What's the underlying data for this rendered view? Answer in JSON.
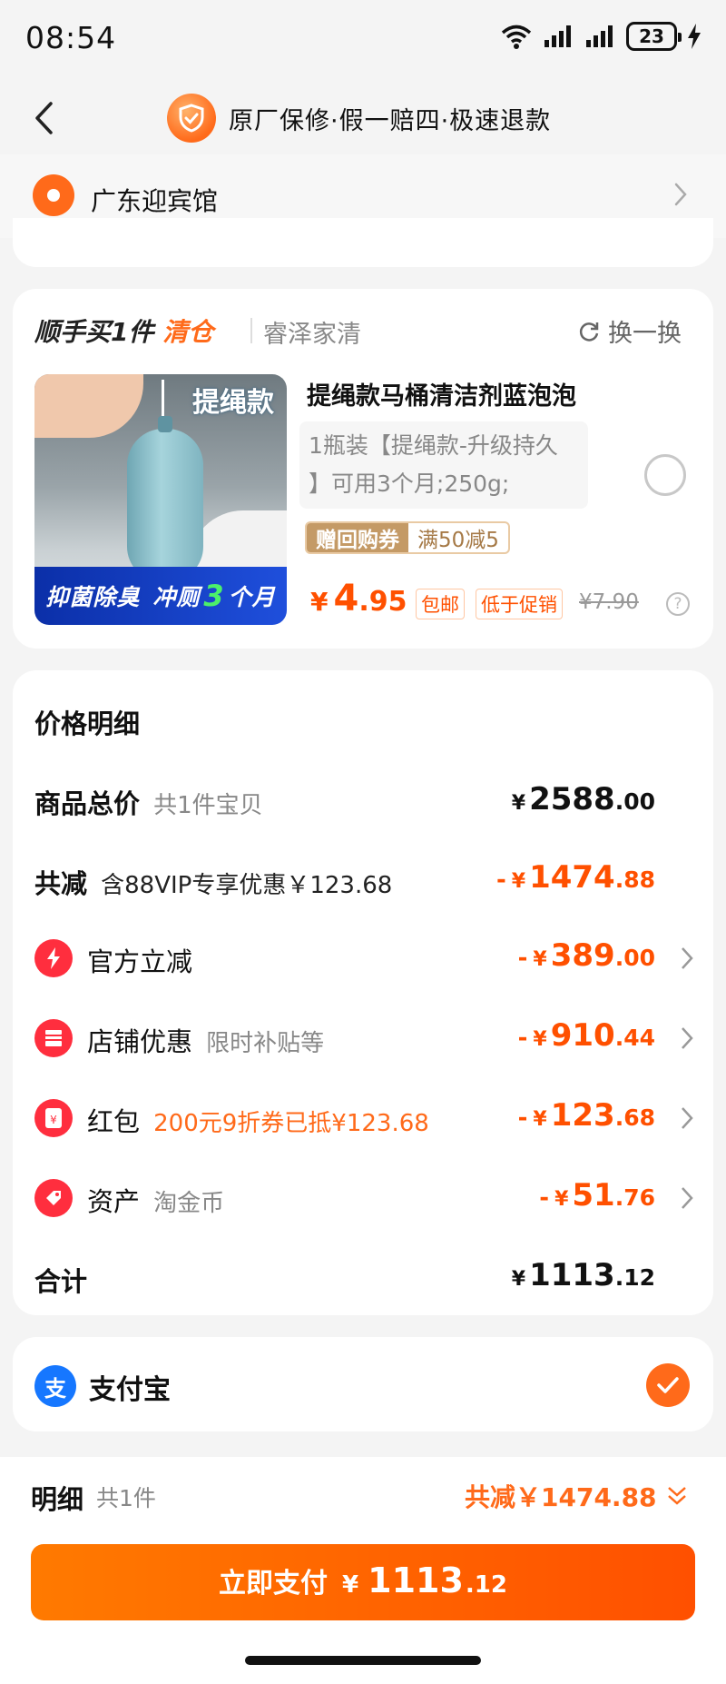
{
  "status_bar": {
    "time": "08:54",
    "battery": "23"
  },
  "header": {
    "guarantee_text": "原厂保修·假一赔四·极速退款"
  },
  "address": {
    "text": "广东迎宾馆"
  },
  "deal": {
    "title": "顺手买1件",
    "tag": "清仓",
    "shop": "睿泽家清",
    "refresh_label": "换一换"
  },
  "product": {
    "image_tag": "提绳款",
    "image_banner_a": "抑菌除臭",
    "image_banner_b": "冲厕",
    "image_banner_num": "3",
    "image_banner_c": "个月",
    "title": "提绳款马桶清洁剂蓝泡泡",
    "spec_line1": "1瓶装【提绳款-升级持久",
    "spec_line2": "】可用3个月;250g;",
    "coupon_left": "赠回购券",
    "coupon_right": "满50减5",
    "price_symbol": "¥",
    "price_int": "4",
    "price_dec": ".95",
    "badge_free": "包邮",
    "badge_promo": "低于促销",
    "original_price": "¥7.90",
    "help": "?"
  },
  "price_detail": {
    "title": "价格明细",
    "subtotal": {
      "label": "商品总价",
      "sub": "共1件宝贝",
      "yen": "¥",
      "int": "2588",
      "dec": ".00"
    },
    "discount": {
      "label": "共减",
      "sub": "含88VIP专享优惠￥123.68",
      "minus": "-",
      "yen": "¥",
      "int": "1474",
      "dec": ".88"
    },
    "items": [
      {
        "label": "官方立减",
        "sub": "",
        "minus": "-",
        "yen": "¥",
        "int": "389",
        "dec": ".00",
        "icon": "lightning-icon",
        "color": "#ff2e3e"
      },
      {
        "label": "店铺优惠",
        "sub": "限时补贴等",
        "minus": "-",
        "yen": "¥",
        "int": "910",
        "dec": ".44",
        "icon": "store-icon",
        "color": "#ff2e3e"
      },
      {
        "label": "红包",
        "sub": "200元9折券已抵¥123.68",
        "minus": "-",
        "yen": "¥",
        "int": "123",
        "dec": ".68",
        "icon": "red-packet-icon",
        "color": "#ff2e3e"
      },
      {
        "label": "资产",
        "sub": "淘金币",
        "minus": "-",
        "yen": "¥",
        "int": "51",
        "dec": ".76",
        "icon": "tag-icon",
        "color": "#ff2e3e"
      }
    ],
    "total": {
      "label": "合计",
      "yen": "¥",
      "int": "1113",
      "dec": ".12"
    }
  },
  "payment": {
    "name": "支付宝",
    "icon_char": "支"
  },
  "bottom": {
    "detail_label": "明细",
    "detail_count": "共1件",
    "total_off": "共减￥1474.88",
    "pay_label": "立即支付",
    "pay_yen": "¥",
    "pay_int": "1113",
    "pay_dec": ".12"
  },
  "colors": {
    "accent": "#ff5000",
    "orange": "#ff6a1a",
    "alipay": "#1677ff"
  }
}
